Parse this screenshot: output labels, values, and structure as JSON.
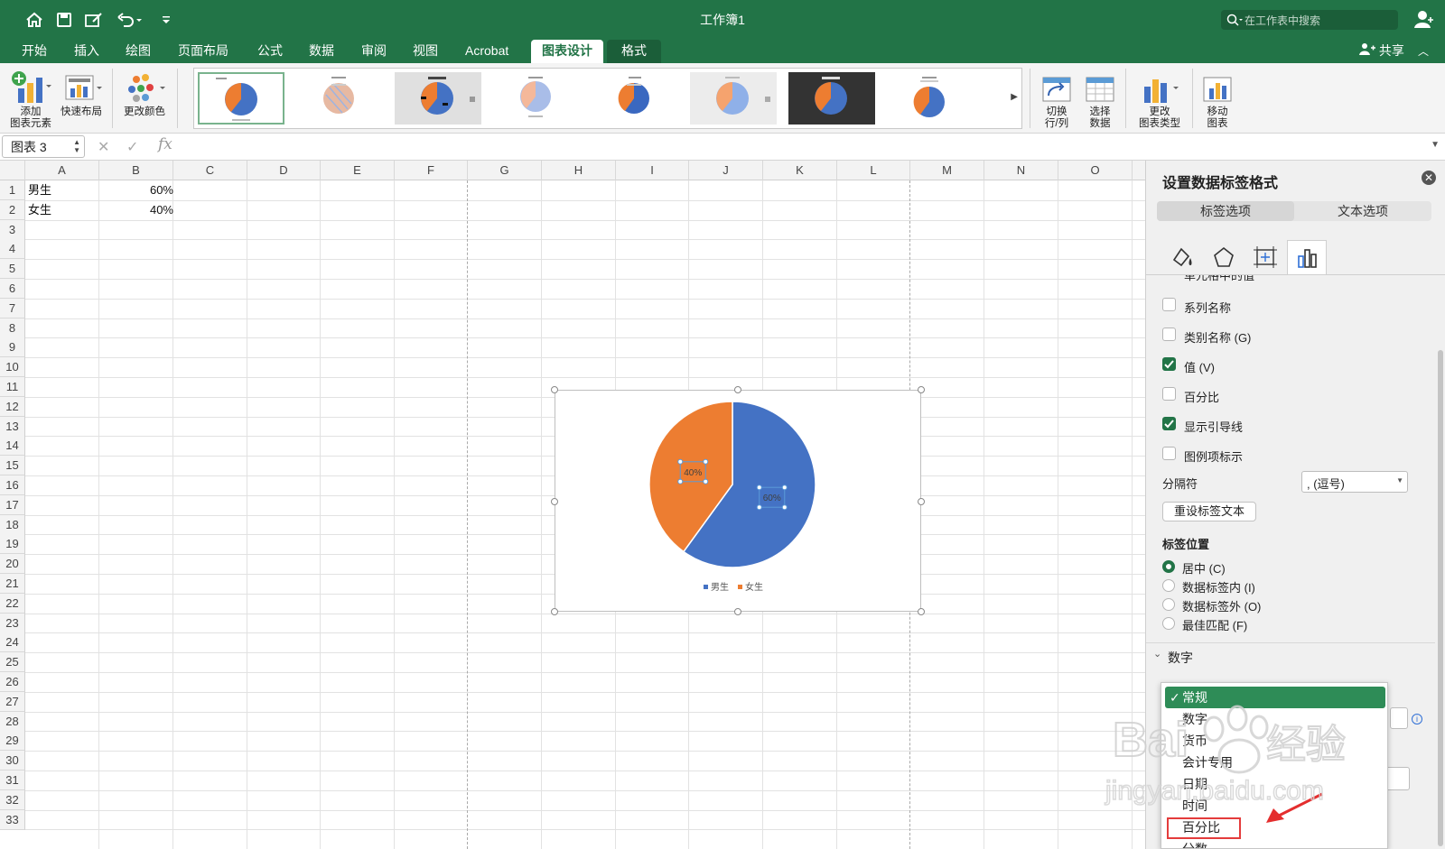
{
  "app": {
    "window_title": "工作簿1",
    "search_placeholder": "在工作表中搜索",
    "share_label": "共享"
  },
  "tabs": [
    "开始",
    "插入",
    "绘图",
    "页面布局",
    "公式",
    "数据",
    "审阅",
    "视图",
    "Acrobat",
    "图表设计",
    "格式"
  ],
  "active_tab": "图表设计",
  "ribbon": {
    "add_element": [
      "添加",
      "图表元素"
    ],
    "quick_layout": "快速布局",
    "change_colors": "更改颜色",
    "switch_row_col": [
      "切换",
      "行/列"
    ],
    "select_data": [
      "选择",
      "数据"
    ],
    "change_type": [
      "更改",
      "图表类型"
    ],
    "move_chart": [
      "移动",
      "图表"
    ]
  },
  "formula_bar": {
    "name_box": "图表 3",
    "fx": "fx"
  },
  "sheet": {
    "columns": [
      "A",
      "B",
      "C",
      "D",
      "E",
      "F",
      "G",
      "H",
      "I",
      "J",
      "K",
      "L",
      "M",
      "N",
      "O"
    ],
    "rows": [
      "1",
      "2",
      "3",
      "4",
      "5",
      "6",
      "7",
      "8",
      "9",
      "10",
      "11",
      "12",
      "13",
      "14",
      "15",
      "16",
      "17",
      "18",
      "19",
      "20",
      "21",
      "22",
      "23",
      "24",
      "25",
      "26",
      "27",
      "28",
      "29",
      "30",
      "31",
      "32",
      "33"
    ],
    "cells": [
      {
        "a": "男生",
        "b": "60%"
      },
      {
        "a": "女生",
        "b": "40%"
      }
    ]
  },
  "chart_data": {
    "type": "pie",
    "categories": [
      "男生",
      "女生"
    ],
    "values": [
      60,
      40
    ],
    "labels": [
      "60%",
      "40%"
    ],
    "colors": [
      "#4472c4",
      "#ed7d31"
    ],
    "legend": "bottom"
  },
  "panel": {
    "title": "设置数据标签格式",
    "tabs": [
      "标签选项",
      "文本选项"
    ],
    "cut_label": "单元格中的值",
    "options": [
      {
        "label": "系列名称",
        "checked": false
      },
      {
        "label": "类别名称 (G)",
        "checked": false
      },
      {
        "label": "值 (V)",
        "checked": true
      },
      {
        "label": "百分比",
        "checked": false
      },
      {
        "label": "显示引导线",
        "checked": true
      },
      {
        "label": "图例项标示",
        "checked": false
      }
    ],
    "separator_label": "分隔符",
    "separator_value": ", (逗号)",
    "reset_button": "重设标签文本",
    "position_title": "标签位置",
    "positions": [
      {
        "label": "居中 (C)",
        "selected": true
      },
      {
        "label": "数据标签内 (I)",
        "selected": false
      },
      {
        "label": "数据标签外 (O)",
        "selected": false
      },
      {
        "label": "最佳匹配 (F)",
        "selected": false
      }
    ],
    "number_section": "数字"
  },
  "dropdown": {
    "items": [
      "常规",
      "数字",
      "货币",
      "会计专用",
      "日期",
      "时间",
      "百分比",
      "分数"
    ],
    "selected": "常规",
    "highlighted": "百分比"
  },
  "watermark": {
    "line1": "Bai",
    "line2": "经验",
    "line3": "jingyan.baidu.com"
  }
}
